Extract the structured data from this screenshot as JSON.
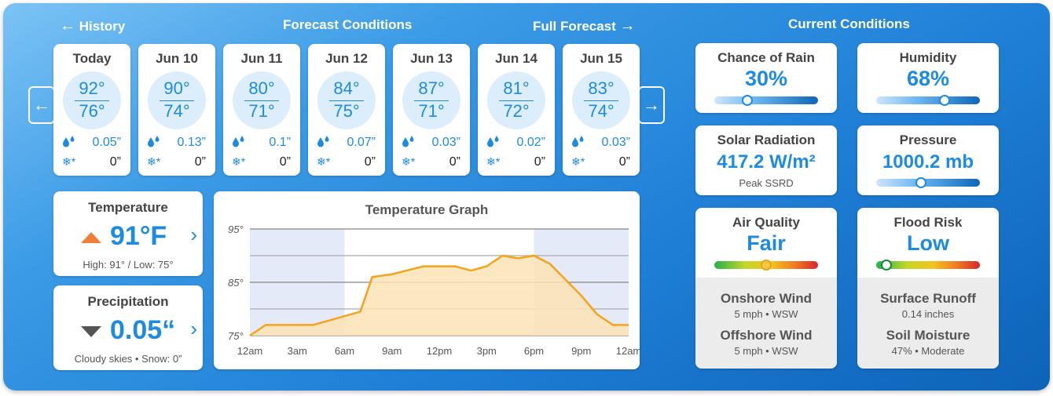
{
  "header": {
    "history_label": "History",
    "forecast_title": "Forecast Conditions",
    "full_forecast_label": "Full Forecast",
    "current_title": "Current Conditions"
  },
  "days": [
    {
      "label": "Today",
      "high": "92°",
      "low": "76°",
      "rain": "0.05”",
      "snow": "0”"
    },
    {
      "label": "Jun 10",
      "high": "90°",
      "low": "74°",
      "rain": "0.13”",
      "snow": "0”"
    },
    {
      "label": "Jun 11",
      "high": "80°",
      "low": "71°",
      "rain": "0.1”",
      "snow": "0”"
    },
    {
      "label": "Jun 12",
      "high": "84°",
      "low": "75°",
      "rain": "0.07”",
      "snow": "0”"
    },
    {
      "label": "Jun 13",
      "high": "87°",
      "low": "71°",
      "rain": "0.03”",
      "snow": "0”"
    },
    {
      "label": "Jun 14",
      "high": "81°",
      "low": "72°",
      "rain": "0.02”",
      "snow": "0”"
    },
    {
      "label": "Jun 15",
      "high": "83°",
      "low": "74°",
      "rain": "0.03”",
      "snow": "0”"
    }
  ],
  "temperature": {
    "title": "Temperature",
    "value": "91°F",
    "sub": "High: 91° / Low: 75°",
    "trend": "up"
  },
  "precipitation": {
    "title": "Precipitation",
    "value": "0.05“",
    "sub": "Cloudy skies • Snow: 0”",
    "trend": "down"
  },
  "graph": {
    "title": "Temperature Graph"
  },
  "chart_data": {
    "type": "area",
    "title": "Temperature Graph",
    "xlabel": "",
    "ylabel": "",
    "x_ticks": [
      "12am",
      "3am",
      "6am",
      "9am",
      "12pm",
      "3pm",
      "6pm",
      "9pm",
      "12am"
    ],
    "y_ticks": [
      "95°",
      "85°",
      "75°"
    ],
    "ylim": [
      75,
      95
    ],
    "xlim": [
      0,
      24
    ],
    "grid": true,
    "night_shading": [
      [
        0,
        6
      ],
      [
        18,
        24
      ]
    ],
    "series": [
      {
        "x": [
          0,
          1,
          4,
          7,
          7.75,
          9,
          11,
          13,
          14,
          15,
          16,
          17,
          18,
          19,
          20,
          21,
          22,
          23,
          24
        ],
        "y": [
          75,
          77,
          77,
          79.5,
          86,
          86.5,
          88,
          88,
          87.2,
          88,
          90,
          89.5,
          90,
          88.5,
          85.5,
          82.5,
          79,
          77,
          77
        ]
      }
    ],
    "colors": {
      "line": "#f5a31a",
      "fill": "#fce3b5",
      "night": "#e4eaf8"
    }
  },
  "conditions": {
    "rain": {
      "title": "Chance of Rain",
      "value": "30%",
      "level": 0.32
    },
    "humidity": {
      "title": "Humidity",
      "value": "68%",
      "level": 0.66
    },
    "solar": {
      "title": "Solar Radiation",
      "value": "417.2 W/m²",
      "note": "Peak SSRD"
    },
    "pressure": {
      "title": "Pressure",
      "value": "1000.2 mb",
      "level": 0.43
    },
    "air": {
      "title": "Air Quality",
      "value": "Fair",
      "level": 0.5
    },
    "flood": {
      "title": "Flood Risk",
      "value": "Low",
      "level": 0.1
    },
    "onshore": {
      "title": "Onshore Wind",
      "value": "5 mph • WSW"
    },
    "offshore": {
      "title": "Offshore Wind",
      "value": "5 mph • WSW"
    },
    "runoff": {
      "title": "Surface Runoff",
      "value": "0.14 inches"
    },
    "soil": {
      "title": "Soil Moisture",
      "value": "47% • Moderate"
    }
  }
}
